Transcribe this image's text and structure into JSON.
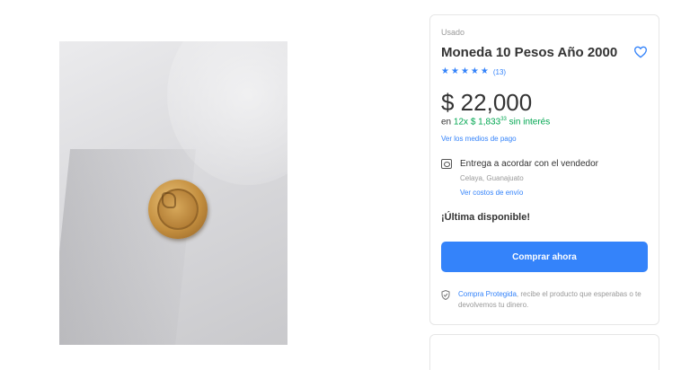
{
  "product": {
    "condition": "Usado",
    "title": "Moneda 10 Pesos Año 2000",
    "rating_count": "(13)",
    "rating_stars": 5,
    "price": "$ 22,000",
    "installments_prefix": "en",
    "installments_count": "12x",
    "installments_amount": "$ 1,833",
    "installments_cents": "33",
    "installments_suffix": "sin interés",
    "payment_methods_link": "Ver los medios de pago"
  },
  "delivery": {
    "label": "Entrega a acordar con el vendedor",
    "location": "Celaya, Guanajuato",
    "shipping_link": "Ver costos de envío"
  },
  "stock_label": "¡Última disponible!",
  "buy_button": "Comprar ahora",
  "protection": {
    "link": "Compra Protegida",
    "text": ", recibe el producto que esperabas o te devolvemos tu dinero."
  },
  "colors": {
    "accent": "#3483fa",
    "green": "#00a650",
    "text": "#333333",
    "muted": "#999999"
  },
  "icons": {
    "favorite": "heart-icon",
    "delivery": "delivery-icon",
    "protection": "shield-icon",
    "star": "star-icon"
  }
}
